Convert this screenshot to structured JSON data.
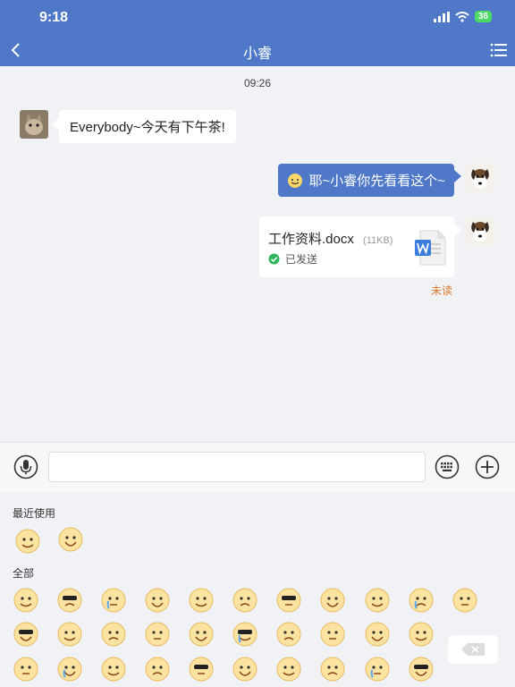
{
  "status": {
    "time": "9:18",
    "battery": "36"
  },
  "nav": {
    "title": "小睿"
  },
  "chat": {
    "timestamp": "09:26",
    "messages": [
      {
        "side": "in",
        "text": "Everybody~今天有下午茶!"
      },
      {
        "side": "out",
        "text": "耶~小睿你先看看这个~"
      }
    ],
    "file": {
      "name": "工作资料.docx",
      "size": "(11KB)",
      "status": "已发送"
    },
    "unread_label": "未读"
  },
  "emoji": {
    "recent_label": "最近使用",
    "all_label": "全部"
  },
  "colors": {
    "brand": "#4f78c9",
    "unread": "#e07a2d",
    "sent_check": "#2fb45a"
  }
}
